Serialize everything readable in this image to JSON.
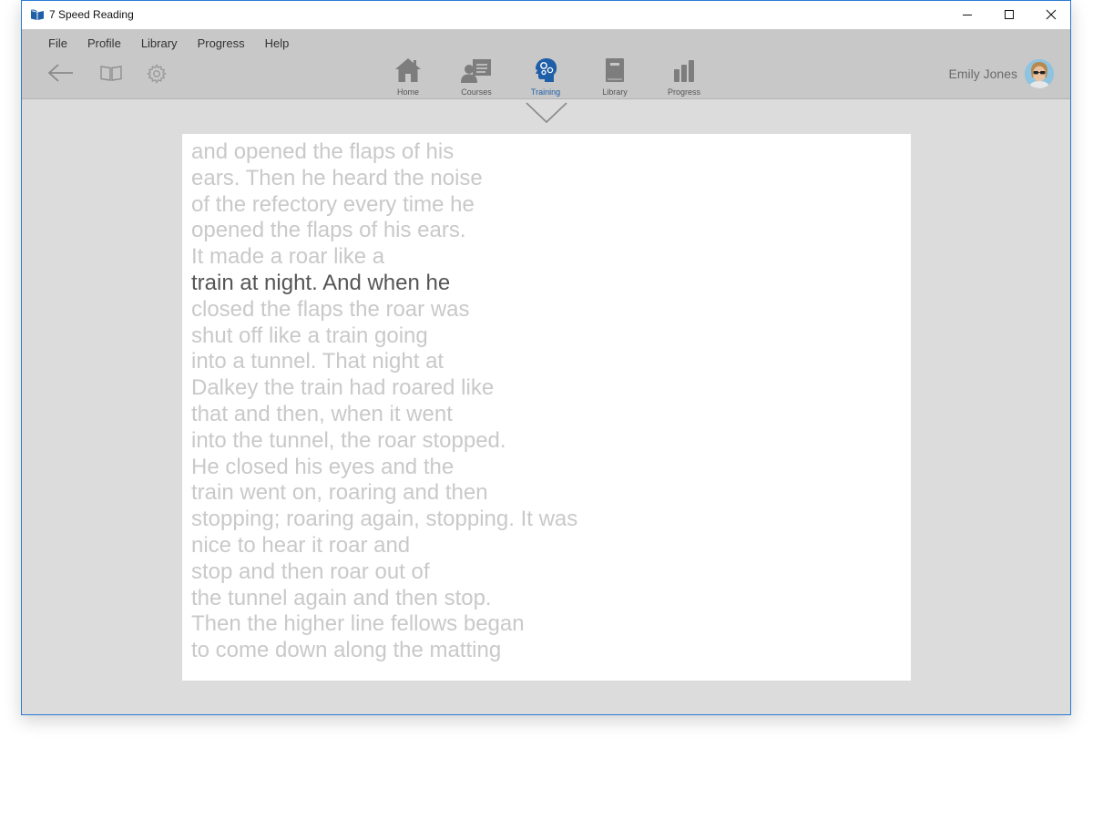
{
  "window": {
    "title": "7 Speed Reading"
  },
  "menu": {
    "items": [
      {
        "label": "File"
      },
      {
        "label": "Profile"
      },
      {
        "label": "Library"
      },
      {
        "label": "Progress"
      },
      {
        "label": "Help"
      }
    ]
  },
  "nav": {
    "home": {
      "label": "Home",
      "icon": "home-icon"
    },
    "courses": {
      "label": "Courses",
      "icon": "courses-icon"
    },
    "training": {
      "label": "Training",
      "icon": "brain-gears-icon"
    },
    "library": {
      "label": "Library",
      "icon": "book-icon"
    },
    "progress": {
      "label": "Progress",
      "icon": "bar-chart-icon"
    },
    "active": "training"
  },
  "user": {
    "name": "Emily Jones"
  },
  "reader": {
    "current_line": 5,
    "lines": [
      "and opened the flaps of his",
      "ears. Then he heard the noise",
      "of the refectory every time he",
      "opened the flaps of his ears.",
      "It made a roar like a",
      "train at night. And when he",
      "closed the flaps the roar was",
      "shut off like a train going",
      "into a tunnel. That night at",
      "Dalkey the train had roared like",
      "that and then, when it went",
      "into the tunnel, the roar stopped.",
      "He closed his eyes and the",
      "train went on, roaring and then",
      "stopping; roaring again, stopping. It was",
      "nice to hear it roar and",
      "stop and then roar out of",
      "the tunnel again and then stop.",
      "Then the higher line fellows began",
      "to come down along the matting"
    ]
  },
  "colors": {
    "accent": "#1f5fa8",
    "text_dim": "#c9c9c9",
    "text_current": "#555555",
    "toolbar": "#c8c8c8",
    "workspace": "#dcdcdc"
  }
}
